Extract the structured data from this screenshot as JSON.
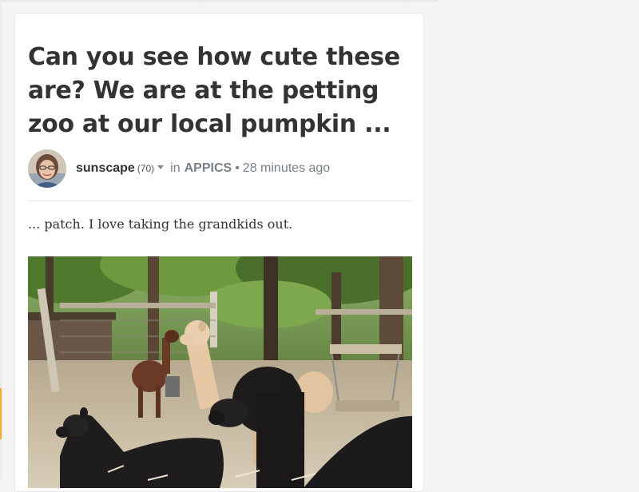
{
  "post": {
    "title": "Can you see how cute these are? We are at the petting zoo at our local pumpkin ...",
    "author": "sunscape",
    "reputation": "(70)",
    "in_label": "in",
    "community": "APPICS",
    "separator": "•",
    "time": "28 minutes ago",
    "body": "... patch. I love taking the grandkids out.",
    "avatar_icon": "user-avatar",
    "dropdown_icon": "caret-down-icon",
    "accent_color": "#f7a630"
  }
}
